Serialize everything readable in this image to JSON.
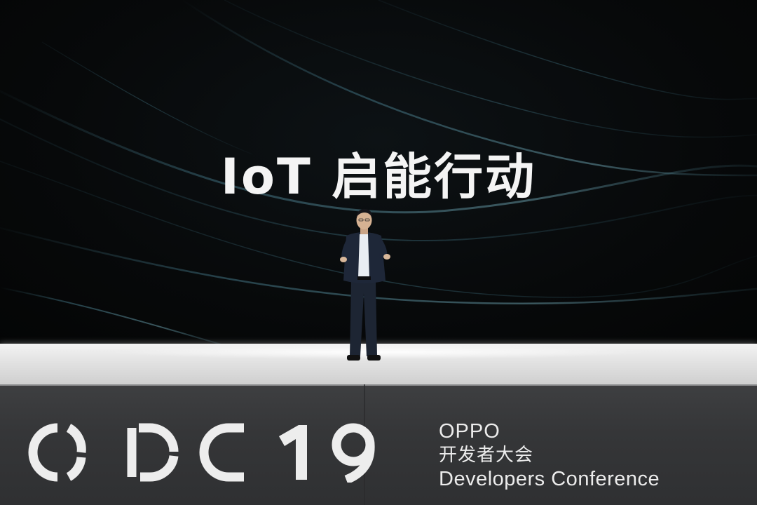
{
  "screen": {
    "headline": "IoT 启能行动"
  },
  "stage_banner": {
    "logo_text": "ODC19",
    "brand_name": "OPPO",
    "event_name_cn": "开发者大会",
    "event_name_en": "Developers Conference"
  },
  "colors": {
    "background": "#060708",
    "wave_accent": "#3f6f7e",
    "headline_text": "#f4f4f4",
    "stage_floor": "#e6e6e6",
    "stage_front": "#3a3b3d",
    "banner_text": "#ececec"
  }
}
